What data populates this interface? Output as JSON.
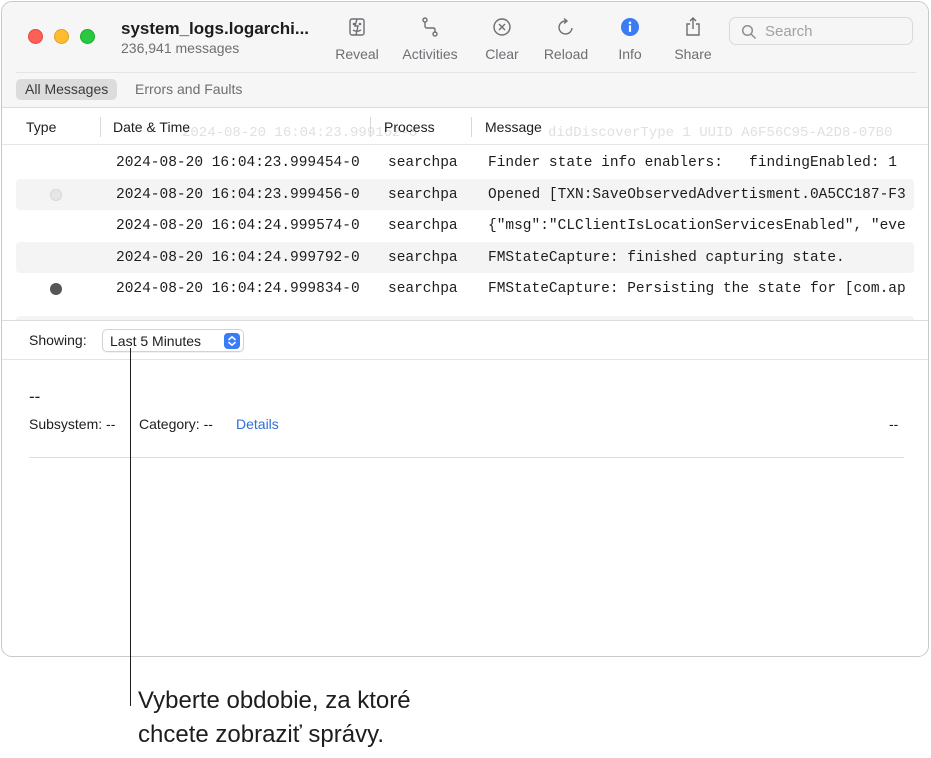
{
  "window": {
    "title": "system_logs.logarchi...",
    "subtitle": "236,941 messages"
  },
  "toolbar": {
    "buttons": [
      {
        "label": "Reveal",
        "icon": "reveal-icon"
      },
      {
        "label": "Activities",
        "icon": "activities-icon"
      },
      {
        "label": "Clear",
        "icon": "clear-icon"
      },
      {
        "label": "Reload",
        "icon": "reload-icon"
      },
      {
        "label": "Info",
        "icon": "info-icon"
      },
      {
        "label": "Share",
        "icon": "share-icon"
      }
    ],
    "search_placeholder": "Search"
  },
  "scope": {
    "all": "All Messages",
    "errors": "Errors and Faults"
  },
  "table": {
    "columns": [
      "Type",
      "Date & Time",
      "Process",
      "Message"
    ],
    "ghost_row": {
      "date": "2024-08-20 16:04:23.999162-0",
      "message": "didDiscoverType 1 UUID A6F56C95-A2D8-07B0"
    },
    "rows": [
      {
        "type": "none",
        "date": "2024-08-20 16:04:23.999454-0",
        "process": "searchpa",
        "message": "Finder state info enablers:   findingEnabled: 1"
      },
      {
        "type": "light",
        "date": "2024-08-20 16:04:23.999456-0",
        "process": "searchpa",
        "message": "Opened [TXN:SaveObservedAdvertisment.0A5CC187-F3"
      },
      {
        "type": "none",
        "date": "2024-08-20 16:04:24.999574-0",
        "process": "searchpa",
        "message": "{\"msg\":\"CLClientIsLocationServicesEnabled\", \"eve"
      },
      {
        "type": "none",
        "date": "2024-08-20 16:04:24.999792-0",
        "process": "searchpa",
        "message": "FMStateCapture: finished capturing state."
      },
      {
        "type": "dark",
        "date": "2024-08-20 16:04:24.999834-0",
        "process": "searchpa",
        "message": "FMStateCapture: Persisting the state for [com.ap"
      }
    ]
  },
  "showing": {
    "label": "Showing:",
    "value": "Last 5 Minutes"
  },
  "detail": {
    "title": "--",
    "subsystem": "Subsystem: --",
    "category": "Category: --",
    "details_link": "Details",
    "right_value": "--"
  },
  "callout": {
    "line1": "Vyberte obdobie, za ktoré",
    "line2": "chcete zobraziť správy."
  },
  "colors": {
    "accent": "#3a7bf6",
    "link": "#2f6fd8",
    "close": "#fe5f57",
    "minimize": "#febc2e",
    "maximize": "#28c840"
  }
}
